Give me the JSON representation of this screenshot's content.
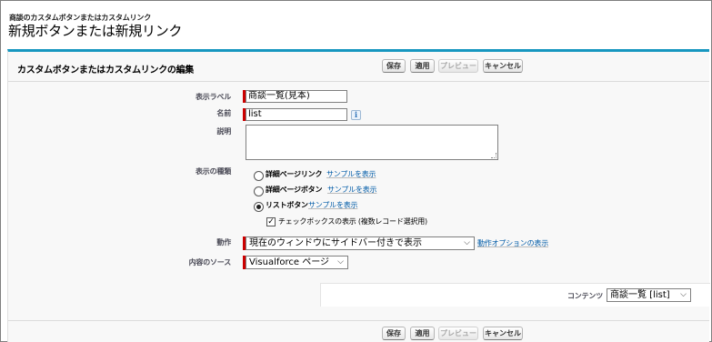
{
  "breadcrumb": "商談のカスタムボタンまたはカスタムリンク",
  "page_title": "新規ボタンまたは新規リンク",
  "panel_title": "カスタムボタンまたはカスタムリンクの編集",
  "buttons": {
    "save": "保存",
    "apply": "適用",
    "preview": "プレビュー",
    "cancel": "キャンセル"
  },
  "fields": {
    "display_label": {
      "label": "表示ラベル",
      "value": "商談一覧(見本)"
    },
    "name": {
      "label": "名前",
      "value": "list",
      "info_icon": "i"
    },
    "description": {
      "label": "説明",
      "value": ""
    },
    "display_type": {
      "label": "表示の種類",
      "options": [
        {
          "label": "詳細ページリンク",
          "link": "サンプルを表示",
          "checked": false
        },
        {
          "label": "詳細ページボタン",
          "link": "サンプルを表示",
          "checked": false
        },
        {
          "label": "リストボタン",
          "link": "サンプルを表示",
          "checked": true
        }
      ],
      "checkbox": {
        "label": "チェックボックスの表示 (複数レコード選択用)",
        "checked": true,
        "mark": "✓"
      }
    },
    "behavior": {
      "label": "動作",
      "value": "現在のウィンドウにサイドバー付きで表示",
      "options_link": "動作オプションの表示"
    },
    "content_source": {
      "label": "内容のソース",
      "value": "Visualforce ページ"
    },
    "content": {
      "label": "コンテンツ",
      "value": "商談一覧 [list]"
    }
  },
  "colors": {
    "accent": "#1797c0",
    "required": "#cc0000",
    "link": "#015ba7"
  }
}
